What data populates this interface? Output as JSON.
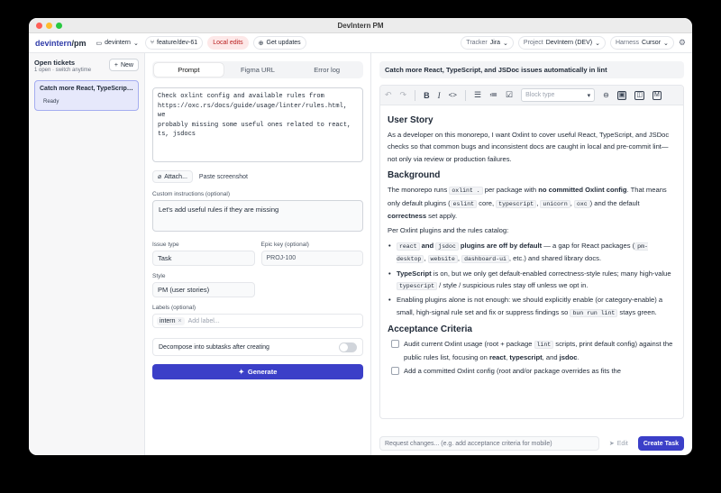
{
  "window": {
    "title": "DevIntern PM"
  },
  "appbar": {
    "brand": "devintern",
    "brand_suffix": "/pm",
    "repo": "devintern",
    "branch": "feature/dev-61",
    "local_edits": "Local edits",
    "get_updates": "Get updates",
    "tracker_label": "Tracker",
    "tracker_value": "Jira",
    "project_label": "Project",
    "project_value": "DevIntern (DEV)",
    "harness_label": "Harness",
    "harness_value": "Cursor"
  },
  "sidebar": {
    "title": "Open tickets",
    "subtitle": "1 open · switch anytime",
    "new_label": "New",
    "tickets": [
      {
        "title": "Catch more React, TypeScript, and JSDoc issues automatically in lint",
        "status": "Ready"
      }
    ]
  },
  "form": {
    "tabs": [
      {
        "label": "Prompt"
      },
      {
        "label": "Figma URL"
      },
      {
        "label": "Error log"
      }
    ],
    "prompt_text": "Check oxlint config and available rules from\nhttps://oxc.rs/docs/guide/usage/linter/rules.html, we\nprobably missing some useful ones related to react,\nts, jsdocs",
    "attach_label": "Attach...",
    "paste_label": "Paste screenshot",
    "custom_label": "Custom instructions (optional)",
    "custom_value": "Let's add useful rules if they are missing",
    "issue_type_label": "Issue type",
    "issue_type_value": "Task",
    "epic_label": "Epic key (optional)",
    "epic_value": "PROJ-100",
    "style_label": "Style",
    "style_value": "PM (user stories)",
    "labels_label": "Labels (optional)",
    "label_chip": "intern",
    "labels_placeholder": "Add label...",
    "decompose_label": "Decompose into subtasks after creating",
    "decompose_on": false,
    "generate_label": "Generate"
  },
  "doc": {
    "title": "Catch more React, TypeScript, and JSDoc issues automatically in lint",
    "block_type_placeholder": "Block type",
    "h_user_story": "User Story",
    "user_story": "As a developer on this monorepo, I want Oxlint to cover useful React, TypeScript, and JSDoc checks so that common bugs and inconsistent docs are caught in local and pre-commit lint—not only via review or production failures.",
    "h_background": "Background",
    "bg1_a": "The monorepo runs ",
    "bg1_code1": "oxlint .",
    "bg1_b": " per package with ",
    "bg1_bold1": "no committed Oxlint config",
    "bg1_c": ". That means only default plugins (",
    "bg1_code2": "eslint",
    "bg1_d": " core, ",
    "bg1_code3": "typescript",
    "bg1_e": ", ",
    "bg1_code4": "unicorn",
    "bg1_f": ", ",
    "bg1_code5": "oxc",
    "bg1_g": ") and the default ",
    "bg1_bold2": "correctness",
    "bg1_h": " set apply.",
    "bg2": "Per Oxlint plugins and the rules catalog:",
    "li1_code1": "react",
    "li1_and": " and ",
    "li1_code2": "jsdoc",
    "li1_bold": " plugins are off by default",
    "li1_a": " — a gap for React packages (",
    "li1_code3": "pm-desktop",
    "li1_b": ", ",
    "li1_code4": "website",
    "li1_c": ", ",
    "li1_code5": "dashboard-ui",
    "li1_d": ", etc.) and shared library docs.",
    "li2_bold": "TypeScript",
    "li2_a": " is on, but we only get default-enabled correctness-style rules; many high-value ",
    "li2_code": "typescript",
    "li2_b": " / style / suspicious rules stay off unless we opt in.",
    "li3_a": "Enabling plugins alone is not enough: we should explicitly enable (or category-enable) a small, high-signal rule set and fix or suppress findings so ",
    "li3_code1": "bun run lint",
    "li3_b": " stays green.",
    "h_acceptance": "Acceptance Criteria",
    "ac1_a": "Audit current Oxlint usage (root + package ",
    "ac1_code": "lint",
    "ac1_b": " scripts, print default config) against the public rules list, focusing on ",
    "ac1_bold1": "react",
    "ac1_c": ", ",
    "ac1_bold2": "typescript",
    "ac1_d": ", and ",
    "ac1_bold3": "jsdoc",
    "ac1_e": ".",
    "ac2": "Add a committed Oxlint config (root and/or package overrides as fits the",
    "request_placeholder": "Request changes... (e.g. add acceptance criteria for mobile)",
    "edit_label": "Edit",
    "create_label": "Create Task"
  },
  "colors": {
    "accent": "#3b3fc8",
    "brand": "#2f3ba8",
    "ticket_bg": "#e6e8fb",
    "danger_bg": "#fde8e8"
  }
}
